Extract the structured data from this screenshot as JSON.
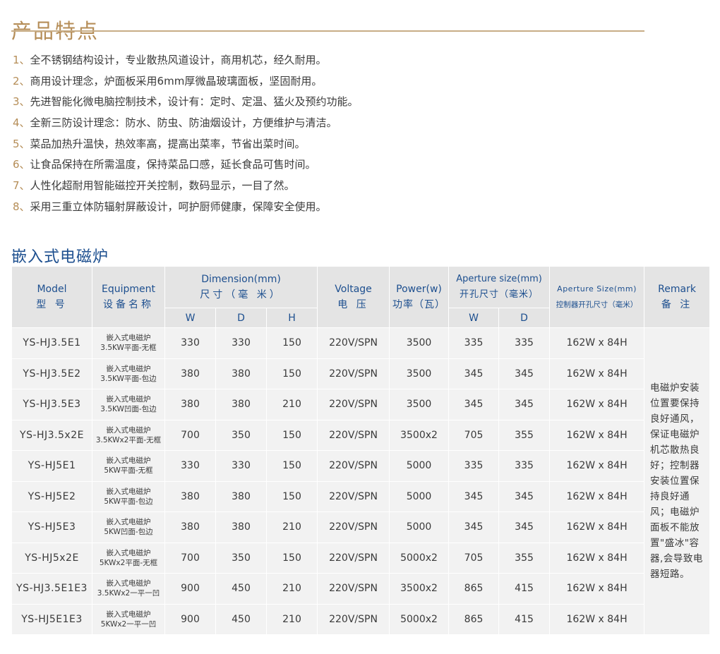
{
  "features_title": "产品特点",
  "features": [
    {
      "num": "1、",
      "text": "全不锈钢结构设计，专业散热风道设计，商用机芯，经久耐用。"
    },
    {
      "num": "2、",
      "text": "商用设计理念，炉面板采用6mm厚微晶玻璃面板，坚固耐用。"
    },
    {
      "num": "3、",
      "text": "先进智能化微电脑控制技术，设计有：定时、定温、猛火及预约功能。"
    },
    {
      "num": "4、",
      "text": "全新三防设计理念：防水、防虫、防油烟设计，方便维护与清洁。"
    },
    {
      "num": "5、",
      "text": "菜品加热升温快，热效率高，提高出菜率，节省出菜时间。"
    },
    {
      "num": "6、",
      "text": "让食品保持在所需温度，保持菜品口感，延长食品可售时间。"
    },
    {
      "num": "7、",
      "text": "人性化超耐用智能磁控开关控制，数码显示，一目了然。"
    },
    {
      "num": "8、",
      "text": "采用三重立体防辐射屏蔽设计，呵护厨师健康，保障安全使用。"
    }
  ],
  "table_title": "嵌入式电磁炉",
  "headers": {
    "model_en": "Model",
    "model_cn": "型 号",
    "equip_en": "Equipment",
    "equip_cn": "设备名称",
    "dim_en": "Dimension(mm)",
    "dim_cn": "尺寸（毫 米）",
    "w": "W",
    "d": "D",
    "h": "H",
    "voltage_en": "Voltage",
    "voltage_cn": "电 压",
    "power_en": "Power(w)",
    "power_cn": "功率（瓦）",
    "aperture_en": "Aperture size(mm)",
    "aperture_cn": "开孔尺寸（毫米）",
    "ap_w": "W",
    "ap_d": "D",
    "ctrl_en": "Aperture Size(mm)",
    "ctrl_cn": "控制器开孔尺寸（毫米）",
    "remark_en": "Remark",
    "remark_cn": "备 注"
  },
  "rows": [
    {
      "model": "YS-HJ3.5E1",
      "equip1": "嵌入式电磁炉",
      "equip2": "3.5KW平面-无框",
      "w": "330",
      "d": "330",
      "h": "150",
      "voltage": "220V/SPN",
      "power": "3500",
      "aw": "335",
      "ad": "335",
      "ctrl": "162W x 84H"
    },
    {
      "model": "YS-HJ3.5E2",
      "equip1": "嵌入式电磁炉",
      "equip2": "3.5KW平面-包边",
      "w": "380",
      "d": "380",
      "h": "150",
      "voltage": "220V/SPN",
      "power": "3500",
      "aw": "345",
      "ad": "345",
      "ctrl": "162W x 84H"
    },
    {
      "model": "YS-HJ3.5E3",
      "equip1": "嵌入式电磁炉",
      "equip2": "3.5KW凹面-包边",
      "w": "380",
      "d": "380",
      "h": "210",
      "voltage": "220V/SPN",
      "power": "3500",
      "aw": "345",
      "ad": "345",
      "ctrl": "162W x 84H"
    },
    {
      "model": "YS-HJ3.5x2E",
      "equip1": "嵌入式电磁炉",
      "equip2": "3.5KWx2平面-无框",
      "w": "700",
      "d": "350",
      "h": "150",
      "voltage": "220V/SPN",
      "power": "3500x2",
      "aw": "705",
      "ad": "355",
      "ctrl": "162W x 84H"
    },
    {
      "model": "YS-HJ5E1",
      "equip1": "嵌入式电磁炉",
      "equip2": "5KW平面-无框",
      "w": "330",
      "d": "330",
      "h": "150",
      "voltage": "220V/SPN",
      "power": "5000",
      "aw": "335",
      "ad": "335",
      "ctrl": "162W x 84H"
    },
    {
      "model": "YS-HJ5E2",
      "equip1": "嵌入式电磁炉",
      "equip2": "5KW平面-包边",
      "w": "380",
      "d": "380",
      "h": "150",
      "voltage": "220V/SPN",
      "power": "5000",
      "aw": "345",
      "ad": "345",
      "ctrl": "162W x 84H"
    },
    {
      "model": "YS-HJ5E3",
      "equip1": "嵌入式电磁炉",
      "equip2": "5KW凹面-包边",
      "w": "380",
      "d": "380",
      "h": "210",
      "voltage": "220V/SPN",
      "power": "5000",
      "aw": "345",
      "ad": "345",
      "ctrl": "162W x 84H"
    },
    {
      "model": "YS-HJ5x2E",
      "equip1": "嵌入式电磁炉",
      "equip2": "5KWx2平面-无框",
      "w": "700",
      "d": "350",
      "h": "150",
      "voltage": "220V/SPN",
      "power": "5000x2",
      "aw": "705",
      "ad": "355",
      "ctrl": "162W x 84H"
    },
    {
      "model": "YS-HJ3.5E1E3",
      "equip1": "嵌入式电磁炉",
      "equip2": "3.5KWx2一平一凹",
      "w": "900",
      "d": "450",
      "h": "210",
      "voltage": "220V/SPN",
      "power": "3500x2",
      "aw": "865",
      "ad": "415",
      "ctrl": "162W x 84H"
    },
    {
      "model": "YS-HJ5E1E3",
      "equip1": "嵌入式电磁炉",
      "equip2": "5KWx2一平一凹",
      "w": "900",
      "d": "450",
      "h": "210",
      "voltage": "220V/SPN",
      "power": "5000x2",
      "aw": "865",
      "ad": "415",
      "ctrl": "162W x 84H"
    }
  ],
  "remark": "电磁炉安装位置要保持良好通风，保证电磁炉机芯散热良好；控制器安装位置保持良好通风；电磁炉面板不能放置\"盛冰\"容器,会导致电器短路。",
  "colors": {
    "gold": "#b58d57",
    "blue": "#1d4f8f",
    "header_bg": "#e4e4e4",
    "cell_bg": "#f2f2f2"
  }
}
